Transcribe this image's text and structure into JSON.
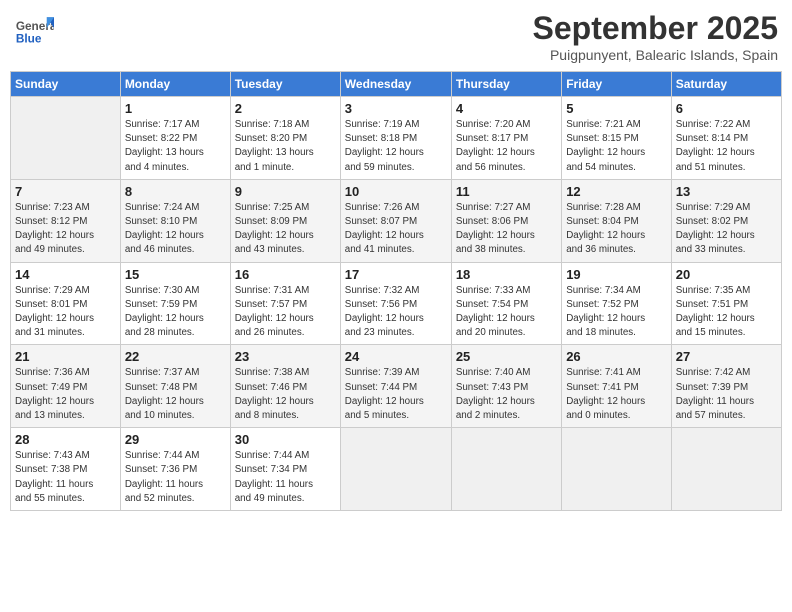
{
  "header": {
    "logo_general": "General",
    "logo_blue": "Blue",
    "month_title": "September 2025",
    "subtitle": "Puigpunyent, Balearic Islands, Spain"
  },
  "days_of_week": [
    "Sunday",
    "Monday",
    "Tuesday",
    "Wednesday",
    "Thursday",
    "Friday",
    "Saturday"
  ],
  "weeks": [
    [
      {
        "day": "",
        "info": ""
      },
      {
        "day": "1",
        "info": "Sunrise: 7:17 AM\nSunset: 8:22 PM\nDaylight: 13 hours\nand 4 minutes."
      },
      {
        "day": "2",
        "info": "Sunrise: 7:18 AM\nSunset: 8:20 PM\nDaylight: 13 hours\nand 1 minute."
      },
      {
        "day": "3",
        "info": "Sunrise: 7:19 AM\nSunset: 8:18 PM\nDaylight: 12 hours\nand 59 minutes."
      },
      {
        "day": "4",
        "info": "Sunrise: 7:20 AM\nSunset: 8:17 PM\nDaylight: 12 hours\nand 56 minutes."
      },
      {
        "day": "5",
        "info": "Sunrise: 7:21 AM\nSunset: 8:15 PM\nDaylight: 12 hours\nand 54 minutes."
      },
      {
        "day": "6",
        "info": "Sunrise: 7:22 AM\nSunset: 8:14 PM\nDaylight: 12 hours\nand 51 minutes."
      }
    ],
    [
      {
        "day": "7",
        "info": "Sunrise: 7:23 AM\nSunset: 8:12 PM\nDaylight: 12 hours\nand 49 minutes."
      },
      {
        "day": "8",
        "info": "Sunrise: 7:24 AM\nSunset: 8:10 PM\nDaylight: 12 hours\nand 46 minutes."
      },
      {
        "day": "9",
        "info": "Sunrise: 7:25 AM\nSunset: 8:09 PM\nDaylight: 12 hours\nand 43 minutes."
      },
      {
        "day": "10",
        "info": "Sunrise: 7:26 AM\nSunset: 8:07 PM\nDaylight: 12 hours\nand 41 minutes."
      },
      {
        "day": "11",
        "info": "Sunrise: 7:27 AM\nSunset: 8:06 PM\nDaylight: 12 hours\nand 38 minutes."
      },
      {
        "day": "12",
        "info": "Sunrise: 7:28 AM\nSunset: 8:04 PM\nDaylight: 12 hours\nand 36 minutes."
      },
      {
        "day": "13",
        "info": "Sunrise: 7:29 AM\nSunset: 8:02 PM\nDaylight: 12 hours\nand 33 minutes."
      }
    ],
    [
      {
        "day": "14",
        "info": "Sunrise: 7:29 AM\nSunset: 8:01 PM\nDaylight: 12 hours\nand 31 minutes."
      },
      {
        "day": "15",
        "info": "Sunrise: 7:30 AM\nSunset: 7:59 PM\nDaylight: 12 hours\nand 28 minutes."
      },
      {
        "day": "16",
        "info": "Sunrise: 7:31 AM\nSunset: 7:57 PM\nDaylight: 12 hours\nand 26 minutes."
      },
      {
        "day": "17",
        "info": "Sunrise: 7:32 AM\nSunset: 7:56 PM\nDaylight: 12 hours\nand 23 minutes."
      },
      {
        "day": "18",
        "info": "Sunrise: 7:33 AM\nSunset: 7:54 PM\nDaylight: 12 hours\nand 20 minutes."
      },
      {
        "day": "19",
        "info": "Sunrise: 7:34 AM\nSunset: 7:52 PM\nDaylight: 12 hours\nand 18 minutes."
      },
      {
        "day": "20",
        "info": "Sunrise: 7:35 AM\nSunset: 7:51 PM\nDaylight: 12 hours\nand 15 minutes."
      }
    ],
    [
      {
        "day": "21",
        "info": "Sunrise: 7:36 AM\nSunset: 7:49 PM\nDaylight: 12 hours\nand 13 minutes."
      },
      {
        "day": "22",
        "info": "Sunrise: 7:37 AM\nSunset: 7:48 PM\nDaylight: 12 hours\nand 10 minutes."
      },
      {
        "day": "23",
        "info": "Sunrise: 7:38 AM\nSunset: 7:46 PM\nDaylight: 12 hours\nand 8 minutes."
      },
      {
        "day": "24",
        "info": "Sunrise: 7:39 AM\nSunset: 7:44 PM\nDaylight: 12 hours\nand 5 minutes."
      },
      {
        "day": "25",
        "info": "Sunrise: 7:40 AM\nSunset: 7:43 PM\nDaylight: 12 hours\nand 2 minutes."
      },
      {
        "day": "26",
        "info": "Sunrise: 7:41 AM\nSunset: 7:41 PM\nDaylight: 12 hours\nand 0 minutes."
      },
      {
        "day": "27",
        "info": "Sunrise: 7:42 AM\nSunset: 7:39 PM\nDaylight: 11 hours\nand 57 minutes."
      }
    ],
    [
      {
        "day": "28",
        "info": "Sunrise: 7:43 AM\nSunset: 7:38 PM\nDaylight: 11 hours\nand 55 minutes."
      },
      {
        "day": "29",
        "info": "Sunrise: 7:44 AM\nSunset: 7:36 PM\nDaylight: 11 hours\nand 52 minutes."
      },
      {
        "day": "30",
        "info": "Sunrise: 7:44 AM\nSunset: 7:34 PM\nDaylight: 11 hours\nand 49 minutes."
      },
      {
        "day": "",
        "info": ""
      },
      {
        "day": "",
        "info": ""
      },
      {
        "day": "",
        "info": ""
      },
      {
        "day": "",
        "info": ""
      }
    ]
  ]
}
